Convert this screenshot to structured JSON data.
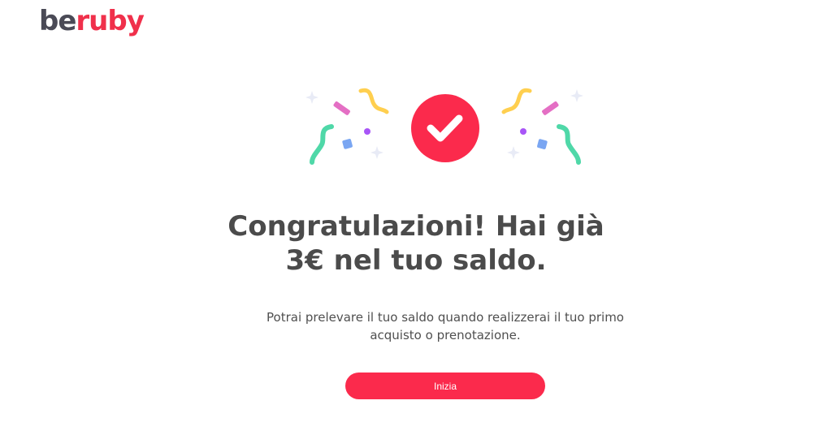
{
  "brand": {
    "logo_part1": "be",
    "logo_part2": "ruby"
  },
  "colors": {
    "accent": "#fb2a4c",
    "text": "#4b4b4b"
  },
  "hero": {
    "icon": "check-icon",
    "decoration": "confetti-icon"
  },
  "main": {
    "title_line1": "Congratulazioni! Hai già",
    "title_line2": "3€ nel tuo saldo.",
    "subtitle_line1": "Potrai prelevare il tuo saldo quando realizzerai il tuo primo",
    "subtitle_line2": "acquisto o prenotazione.",
    "cta_label": "Inizia"
  }
}
